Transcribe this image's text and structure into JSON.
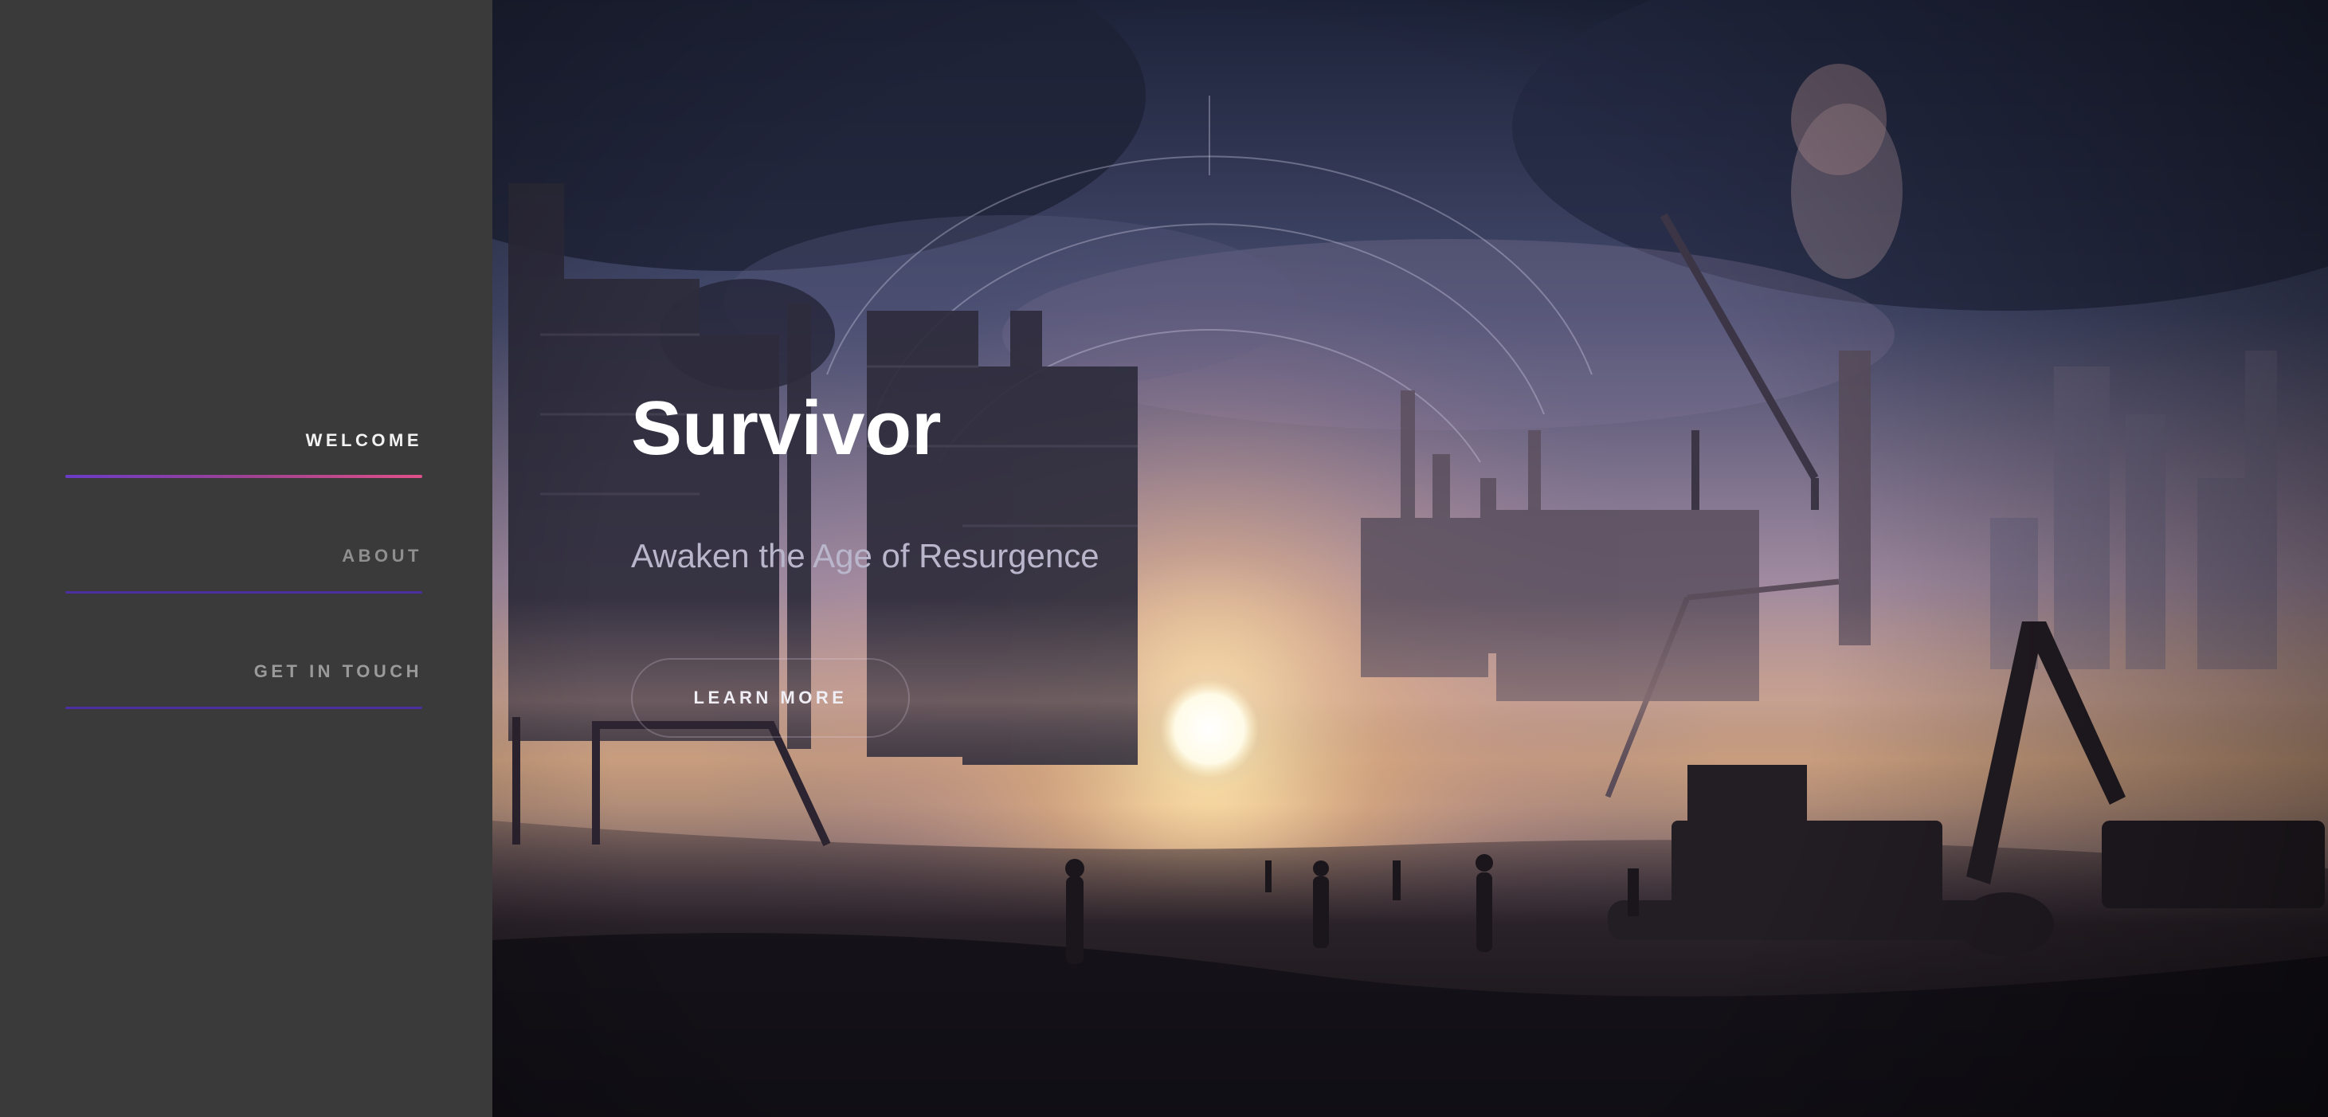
{
  "sidebar": {
    "items": [
      {
        "label": "WELCOME",
        "active": true
      },
      {
        "label": "ABOUT",
        "active": false
      },
      {
        "label": "GET IN TOUCH",
        "active": false
      }
    ],
    "accent_gradient": [
      "#6a3bc7",
      "#e0508a"
    ],
    "underline_color": "#4b2f9e",
    "background_color": "#3a3a3a"
  },
  "hero": {
    "title": "Survivor",
    "subtitle": "Awaken the Age of Resurgence",
    "cta_label": "LEARN MORE",
    "background_image": "industrial-sunset-scene"
  }
}
